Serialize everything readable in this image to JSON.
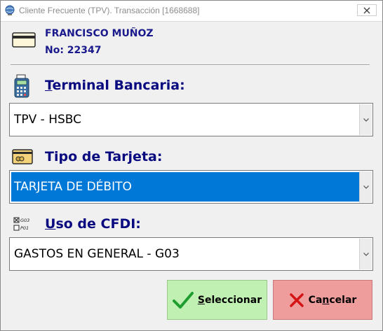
{
  "window": {
    "title": "Cliente Frecuente (TPV). Transacción [1668688]",
    "icon": "app-globe-icon",
    "close_icon": "close-icon"
  },
  "customer": {
    "icon": "card-icon",
    "name": "FRANCISCO MUÑOZ",
    "number": "No: 22347"
  },
  "terminal": {
    "icon": "pos-terminal-icon",
    "label_accel": "T",
    "label_rest": "erminal Bancaria:",
    "selected_value": "TPV - HSBC"
  },
  "card_type": {
    "icon": "credit-card-icon",
    "label": "Tipo de Tarjeta:",
    "selected_value": "TARJETA DE DÉBITO"
  },
  "cfdi": {
    "icon": "cfdi-checkbox-icon",
    "icon_codes": [
      "G03",
      "P01"
    ],
    "label_accel": "U",
    "label_rest": "so de CFDI:",
    "selected_value": "GASTOS EN GENERAL - G03"
  },
  "buttons": {
    "select_accel": "S",
    "select_rest": "eleccionar",
    "select_icon": "checkmark-icon",
    "cancel_pre": "Ca",
    "cancel_accel": "n",
    "cancel_rest": "celar",
    "cancel_icon": "x-icon"
  },
  "colors": {
    "label_blue": "#0a0a80",
    "selection_blue": "#0078d7",
    "select_button": "#c0f0b2",
    "cancel_button": "#ef9c9c"
  }
}
